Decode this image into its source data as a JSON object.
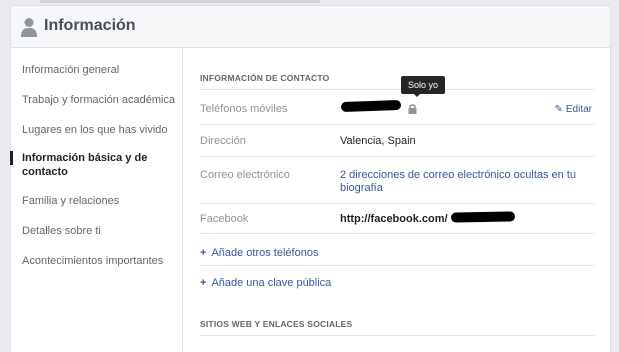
{
  "header": {
    "title": "Información",
    "icon": "person-icon"
  },
  "sidebar": {
    "items": [
      {
        "label": "Información general"
      },
      {
        "label": "Trabajo y formación académica"
      },
      {
        "label": "Lugares en los que has vivido"
      },
      {
        "label": "Información básica y de contacto",
        "active": true
      },
      {
        "label": "Familia y relaciones"
      },
      {
        "label": "Detalles sobre ti"
      },
      {
        "label": "Acontecimientos importantes"
      }
    ]
  },
  "contact": {
    "section_title": "INFORMACIÓN DE CONTACTO",
    "tooltip": "Solo yo",
    "edit_label": "Editar",
    "phones_label": "Teléfonos móviles",
    "address_label": "Dirección",
    "address_value": "Valencia, Spain",
    "email_label": "Correo electrónico",
    "email_value_line1": "2 direcciones de correo electrónico ocultas en tu",
    "email_value_line2": "biografía",
    "facebook_label": "Facebook",
    "facebook_value": "http://facebook.com/",
    "add_phones": "Añade otros teléfonos",
    "add_key": "Añade una clave pública"
  },
  "websites": {
    "section_title": "SITIOS WEB Y ENLACES SOCIALES"
  },
  "colors": {
    "link": "#365899",
    "text": "#1d2129",
    "muted": "#90949c"
  }
}
